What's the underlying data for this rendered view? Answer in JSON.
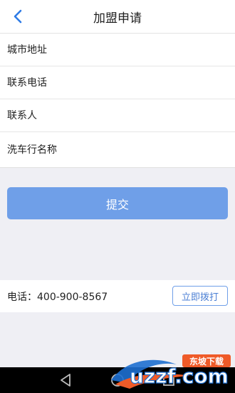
{
  "header": {
    "title": "加盟申请",
    "back_icon": "chevron-left-icon"
  },
  "form": {
    "fields": [
      {
        "placeholder": "城市地址",
        "value": ""
      },
      {
        "placeholder": "联系电话",
        "value": ""
      },
      {
        "placeholder": "联系人",
        "value": ""
      },
      {
        "placeholder": "洗车行名称",
        "value": ""
      }
    ]
  },
  "submit": {
    "label": "提交"
  },
  "contact": {
    "phone_text": "电话：400-900-8567",
    "call_label": "立即拨打"
  },
  "navbar": {
    "icons": [
      "back-triangle-icon",
      "home-circle-icon",
      "recents-square-icon"
    ]
  },
  "watermark": {
    "site": "uzzf.com",
    "slogan": "东坡下载"
  },
  "colors": {
    "accent": "#6f9fe8",
    "back_arrow": "#2e7be6",
    "background": "#efeff4"
  }
}
